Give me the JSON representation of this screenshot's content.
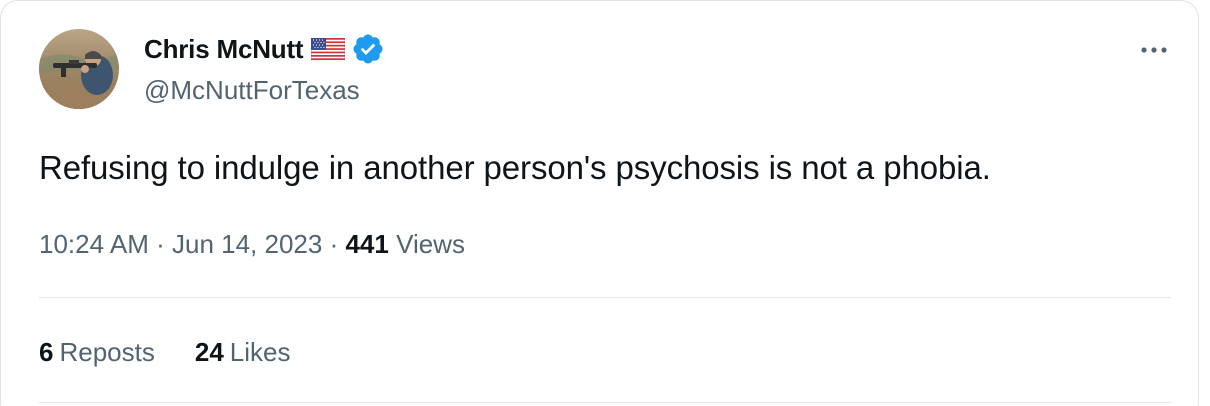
{
  "author": {
    "display_name": "Chris McNutt",
    "handle": "@McNuttForTexas",
    "flag_icon": "us-flag-icon",
    "verified_icon": "verified-badge-icon",
    "verified_color": "#1d9bf0"
  },
  "tweet": {
    "text": "Refusing to indulge in another person's psychosis is not a phobia.",
    "time": "10:24 AM",
    "separator": "·",
    "date": "Jun 14, 2023",
    "views_count": "441",
    "views_label": "Views"
  },
  "stats": {
    "reposts_count": "6",
    "reposts_label": "Reposts",
    "likes_count": "24",
    "likes_label": "Likes"
  },
  "colors": {
    "text_primary": "#0f1419",
    "text_secondary": "#536471",
    "border": "#dfe3e6"
  },
  "icons": {
    "more": "more-options-icon"
  }
}
